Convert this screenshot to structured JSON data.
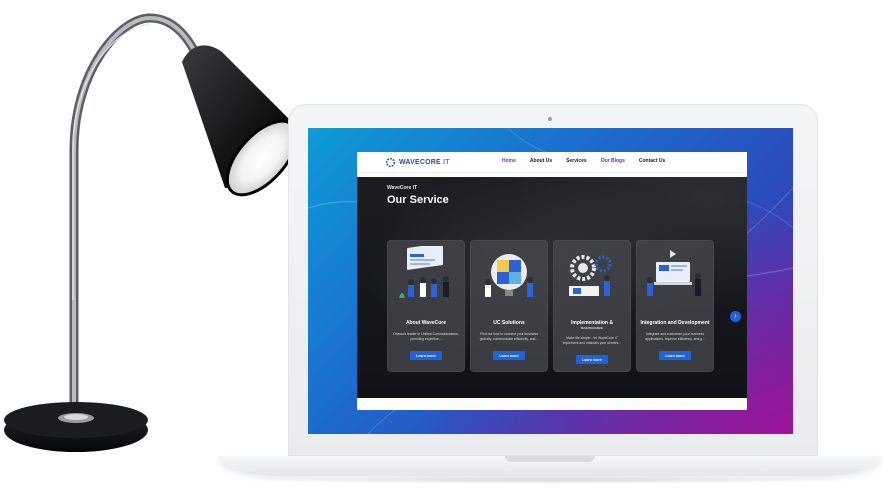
{
  "site": {
    "logo": {
      "name": "WAVECORE",
      "suffix": " IT"
    },
    "nav": [
      {
        "label": "Home",
        "state": "active"
      },
      {
        "label": "About Us",
        "state": "normal"
      },
      {
        "label": "Services",
        "state": "normal"
      },
      {
        "label": "Our Blogs",
        "state": "highlight"
      },
      {
        "label": "Contact Us",
        "state": "normal"
      }
    ],
    "hero": {
      "kicker": "WaveCore IT",
      "title": "Our Service"
    },
    "cards": [
      {
        "title": "About WaveCore",
        "subtitle": "",
        "desc": "Ottawa's leader in Unified Communications, providing expertise...",
        "button": "Learn more",
        "icon": "team-dashboard-illustration"
      },
      {
        "title": "UC Solutions",
        "subtitle": "",
        "desc": "Find out how to connect your business globally, communicate efficiently, and...",
        "button": "Learn more",
        "icon": "puzzle-lightbulb-illustration"
      },
      {
        "title": "Implementation &",
        "subtitle": "MAINTENANCE",
        "desc": "Make life simple - let WaveCore IT implement and maintain your servers...",
        "button": "Learn more",
        "icon": "gear-engineer-illustration"
      },
      {
        "title": "Integration and Development",
        "subtitle": "",
        "desc": "Integrate and customize your business applications, improve efficiency, and g...",
        "button": "Learn more",
        "icon": "developer-workstation-illustration"
      }
    ],
    "carousel_next_icon": "chevron-right-icon"
  },
  "colors": {
    "brand_blue": "#1f4fb8",
    "button_blue": "#1f63d8",
    "nav_active": "#7a2fb0",
    "hero_bg": "#141519"
  }
}
